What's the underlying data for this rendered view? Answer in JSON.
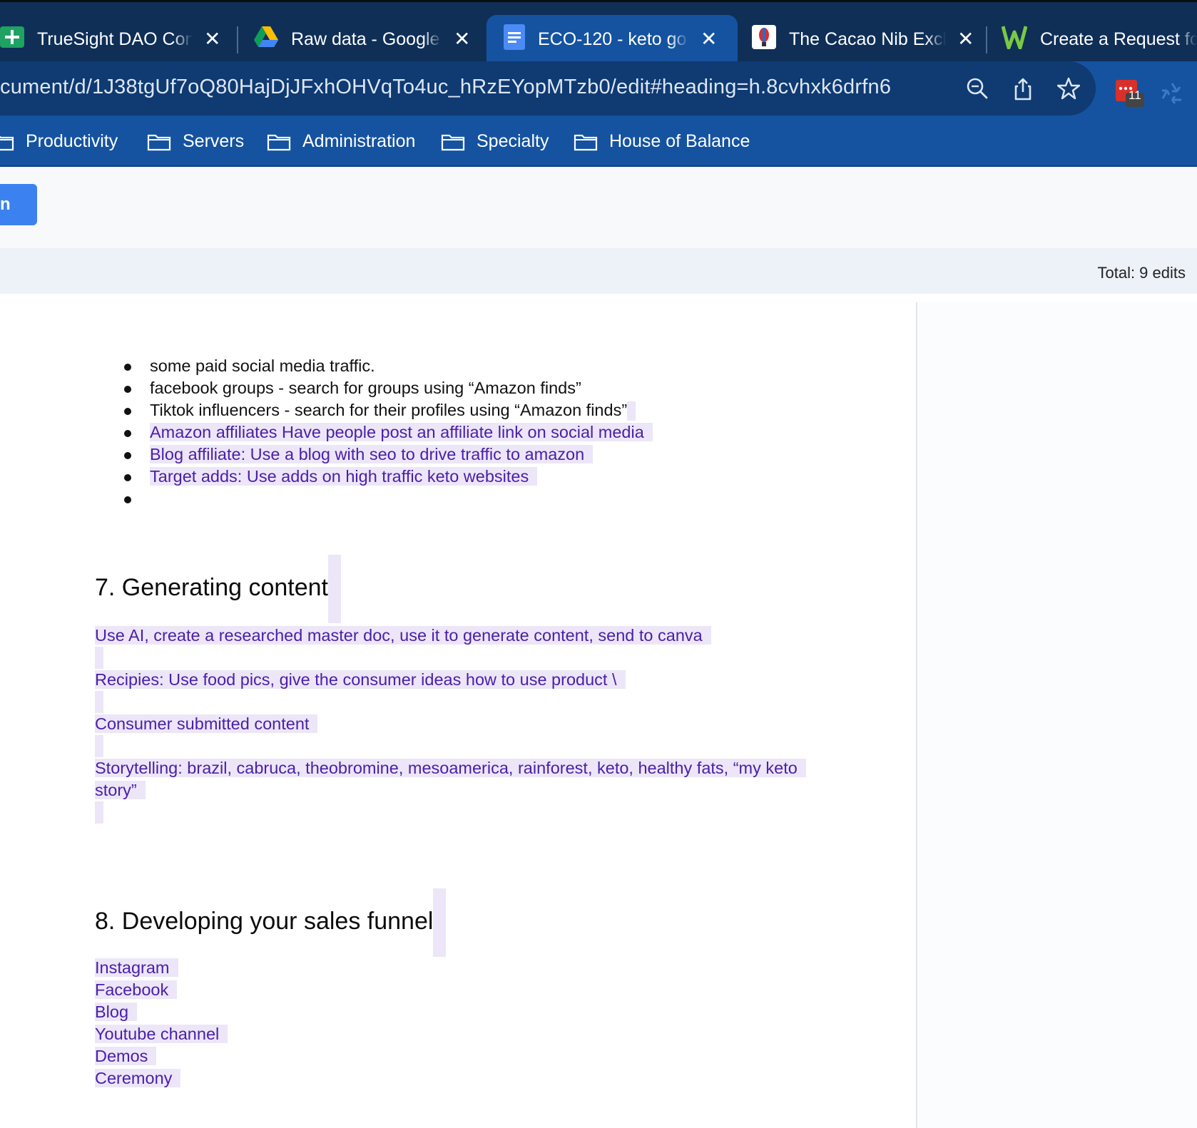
{
  "tabs": [
    {
      "title": "TrueSight DAO Cont",
      "favicon": "sheets-icon",
      "active": false
    },
    {
      "title": "Raw data - Google D",
      "favicon": "drive-icon",
      "active": false
    },
    {
      "title": "ECO-120 - keto go t",
      "favicon": "docs-icon",
      "active": true
    },
    {
      "title": "The Cacao Nib Exch",
      "favicon": "cacao-icon",
      "active": false
    },
    {
      "title": "Create a Request fo",
      "favicon": "w-icon",
      "active": false
    }
  ],
  "address_bar": {
    "url": "cument/d/1J38tgUf7oQ80HajDjJFxhOHVqTo4uc_hRzEYopMTzb0/edit#heading=h.8cvhxk6drfn6"
  },
  "extension_badge": "11",
  "bookmarks": [
    "Productivity",
    "Servers",
    "Administration",
    "Specialty",
    "House of Balance"
  ],
  "page": {
    "button_label": "n",
    "total_edits": "Total: 9 edits"
  },
  "doc": {
    "bullets": [
      {
        "text": "some paid social media traffic.",
        "suggested": false
      },
      {
        "text": "facebook groups - search for groups using “Amazon finds”",
        "suggested": false
      },
      {
        "text": "Tiktok influencers - search for their profiles using “Amazon finds”",
        "suggested": "partial"
      },
      {
        "text": "Amazon affiliates   Have people post an affiliate link on social media",
        "suggested": true
      },
      {
        "text": "Blog affiliate: Use a blog with seo to drive traffic to amazon",
        "suggested": true
      },
      {
        "text": "Target adds:   Use adds on high traffic keto websites",
        "suggested": true
      },
      {
        "text": "",
        "suggested": false
      }
    ],
    "section7": {
      "heading": "7. Generating content",
      "paragraphs": [
        "Use AI, create a researched master doc, use it to generate content, send to canva",
        "Recipies:   Use food pics, give the consumer ideas how to use product \\",
        "Consumer submitted content",
        "Storytelling:   brazil, cabruca, theobromine, mesoamerica, rainforest, keto, healthy fats, “my keto",
        "story”"
      ]
    },
    "section8": {
      "heading": "8. Developing your sales funnel",
      "items": [
        "Instagram",
        "Facebook",
        "Blog",
        "Youtube channel",
        "Demos",
        "Ceremony"
      ]
    }
  },
  "colors": {
    "tabstrip": "#0f2f57",
    "toolbar": "#1553a0",
    "suggestion_text": "#4b20a8",
    "suggestion_highlight": "#ece6f8"
  }
}
